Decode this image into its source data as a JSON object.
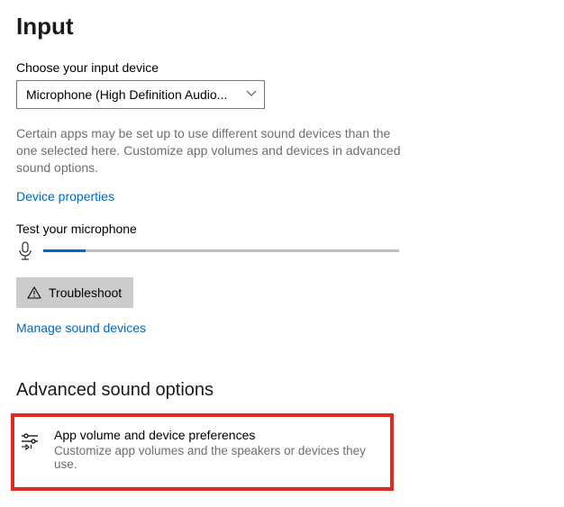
{
  "input": {
    "heading": "Input",
    "device_label": "Choose your input device",
    "device_select": {
      "value": "Microphone (High Definition Audio..."
    },
    "device_help": "Certain apps may be set up to use different sound devices than the one selected here. Customize app volumes and devices in advanced sound options.",
    "device_props_link": "Device properties",
    "test_label": "Test your microphone",
    "test_level_pct": 12,
    "troubleshoot_btn": "Troubleshoot",
    "manage_link": "Manage sound devices"
  },
  "advanced": {
    "heading": "Advanced sound options",
    "row": {
      "title": "App volume and device preferences",
      "subtitle": "Customize app volumes and the speakers or devices they use."
    }
  },
  "colors": {
    "link": "#0067c0",
    "highlight_border": "#dd2b20"
  }
}
